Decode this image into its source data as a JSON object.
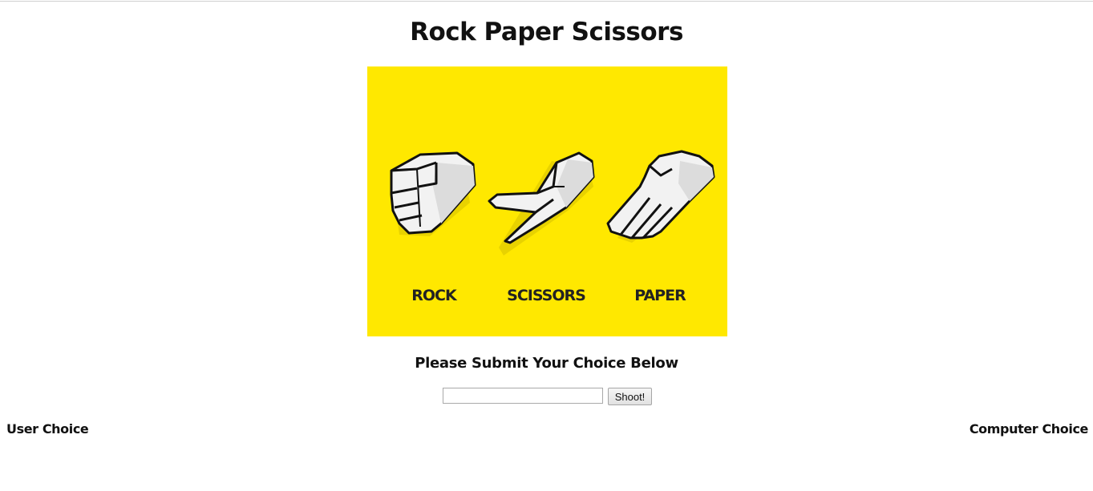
{
  "page": {
    "title": "Rock Paper Scissors"
  },
  "hero": {
    "background": "#ffe800",
    "hands": [
      {
        "label": "ROCK",
        "icon": "rock-hand-icon"
      },
      {
        "label": "SCISSORS",
        "icon": "scissors-hand-icon"
      },
      {
        "label": "PAPER",
        "icon": "paper-hand-icon"
      }
    ]
  },
  "form": {
    "prompt": "Please Submit Your Choice Below",
    "input_value": "",
    "input_placeholder": "",
    "submit_label": "Shoot!"
  },
  "results": {
    "user_label": "User Choice",
    "computer_label": "Computer Choice"
  }
}
